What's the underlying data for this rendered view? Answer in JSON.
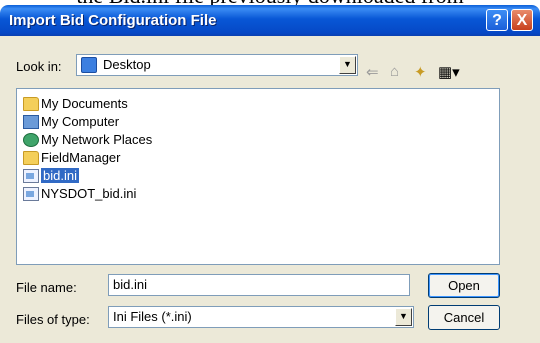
{
  "background_text": "the Bid.ini file previously downloaded from",
  "dialog": {
    "title": "Import Bid Configuration File",
    "help_glyph": "?",
    "close_glyph": "X"
  },
  "look_in": {
    "label": "Look in:",
    "value": "Desktop",
    "icon": "desktop-icon"
  },
  "toolbar": {
    "back_glyph": "⇐",
    "up_glyph": "⌂",
    "new_folder_glyph": "✦",
    "views_glyph": "▦▾"
  },
  "files": [
    {
      "label": "My Documents",
      "icon": "folder-icon"
    },
    {
      "label": "My Computer",
      "icon": "computer-icon"
    },
    {
      "label": "My Network Places",
      "icon": "network-places-icon"
    },
    {
      "label": "FieldManager",
      "icon": "folder-icon"
    },
    {
      "label": "bid.ini",
      "icon": "ini-file-icon",
      "selected": true
    },
    {
      "label": "NYSDOT_bid.ini",
      "icon": "ini-file-icon"
    }
  ],
  "file_name": {
    "label": "File name:",
    "value": "bid.ini"
  },
  "files_of_type": {
    "label": "Files of type:",
    "value": "Ini Files (*.ini)"
  },
  "buttons": {
    "open": "Open",
    "cancel": "Cancel"
  },
  "colors": {
    "titlebar": "#0857d6",
    "selection": "#316ac5",
    "dialog_bg": "#ece9d8"
  }
}
